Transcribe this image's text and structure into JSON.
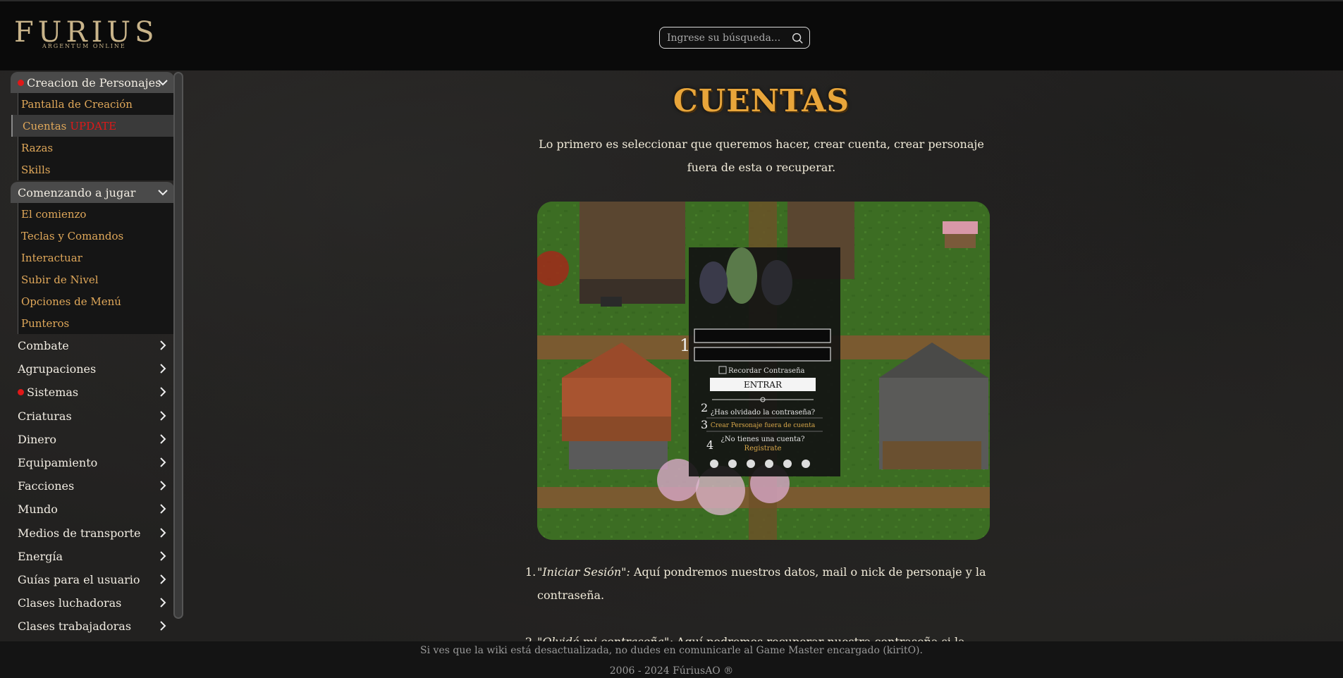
{
  "header": {
    "logo_text": "FURIUS",
    "logo_subtext": "ARGENTUM ONLINE",
    "search_placeholder": "Ingrese su búsqueda..."
  },
  "sidebar": {
    "groups": [
      {
        "label": "Creacion de Personajes",
        "marked": true,
        "items": [
          {
            "label": "Pantalla de Creación"
          },
          {
            "label": "Cuentas",
            "badge": "UPDATE",
            "active": true
          },
          {
            "label": "Razas"
          },
          {
            "label": "Skills"
          }
        ]
      },
      {
        "label": "Comenzando a jugar",
        "items": [
          {
            "label": "El comienzo"
          },
          {
            "label": "Teclas y Comandos"
          },
          {
            "label": "Interactuar"
          },
          {
            "label": "Subir de Nivel"
          },
          {
            "label": "Opciones de Menú"
          },
          {
            "label": "Punteros"
          }
        ]
      }
    ],
    "categories": [
      {
        "label": "Combate"
      },
      {
        "label": "Agrupaciones"
      },
      {
        "label": "Sistemas",
        "marked": true
      },
      {
        "label": "Criaturas"
      },
      {
        "label": "Dinero"
      },
      {
        "label": "Equipamiento"
      },
      {
        "label": "Facciones"
      },
      {
        "label": "Mundo"
      },
      {
        "label": "Medios de transporte"
      },
      {
        "label": "Energía"
      },
      {
        "label": "Guías para el usuario"
      },
      {
        "label": "Clases luchadoras"
      },
      {
        "label": "Clases trabajadoras"
      }
    ]
  },
  "main": {
    "title": "CUENTAS",
    "intro": "Lo primero es seleccionar que queremos hacer, crear cuenta, crear personaje fuera de esta o recuperar.",
    "game_login": {
      "remember": "Recordar Contraseña",
      "enter_button": "ENTRAR",
      "forgot": "¿Has olvidado la contraseña?",
      "create_char": "Crear Personaje fuera de cuenta",
      "no_account": "¿No tienes una cuenta?",
      "register": "Registrate",
      "marker_1": "1",
      "marker_2": "2",
      "marker_3": "3",
      "marker_4": "4"
    },
    "list": [
      {
        "num": "1.",
        "title": "\"Iniciar Sesión\":",
        "text": " Aquí pondremos nuestros datos, mail o nick de personaje y la contraseña."
      },
      {
        "num": "2.",
        "title": "\"Olvidé mi contraseña\":",
        "text": " Aquí podremos recuperar nuestra contraseña si la olvidamos."
      }
    ]
  },
  "footer": {
    "notice": "Si ves que la wiki está desactualizada, no dudes en comunicarle al Game Master encargado (kiritO).",
    "copyright": "2006 - 2024 FúriusAO ®"
  },
  "colors": {
    "accent_orange": "#e0a85a",
    "title_gold": "#e8a53a",
    "update_red": "#e01818"
  }
}
